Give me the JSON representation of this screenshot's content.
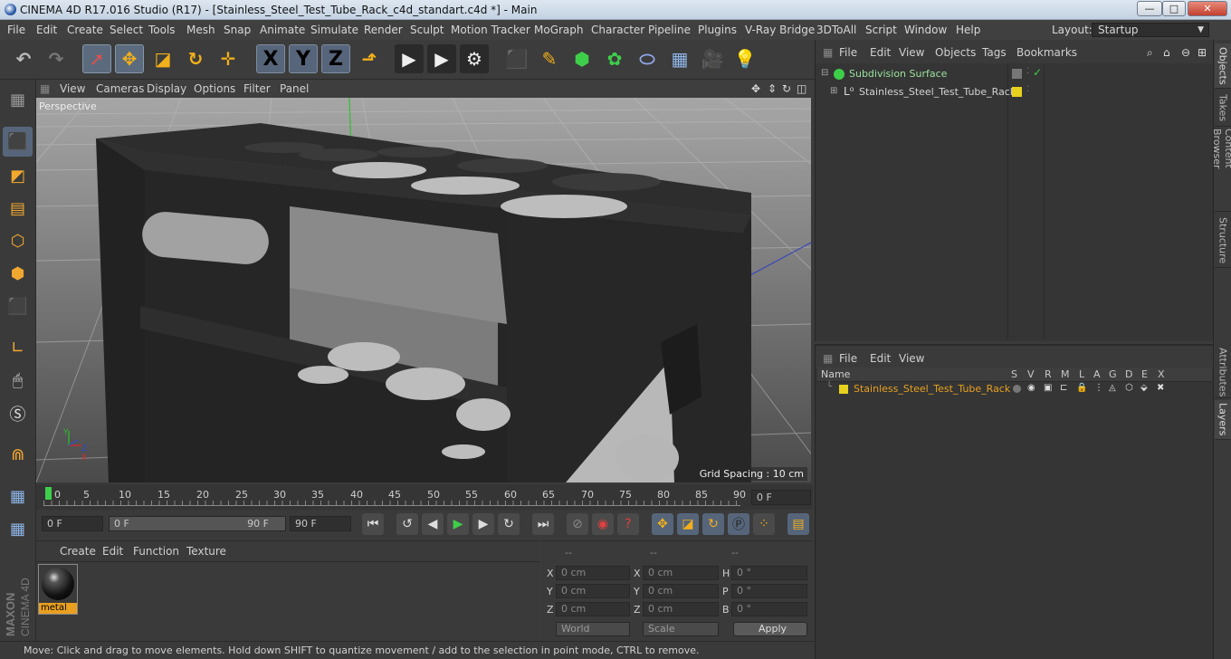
{
  "window": {
    "title": "CINEMA 4D R17.016 Studio (R17) - [Stainless_Steel_Test_Tube_Rack_c4d_standart.c4d *] - Main",
    "minimize": "—",
    "maximize": "□",
    "close": "✕"
  },
  "menu": {
    "items": [
      "File",
      "Edit",
      "Create",
      "Select",
      "Tools",
      "Mesh",
      "Snap",
      "Animate",
      "Simulate",
      "Render",
      "Sculpt",
      "Motion Tracker",
      "MoGraph",
      "Character",
      "Pipeline",
      "Plugins",
      "V-Ray Bridge",
      "3DToAll",
      "Script",
      "Window",
      "Help"
    ],
    "layout_label": "Layout:",
    "layout_value": "Startup"
  },
  "toolbar": {
    "axis_x": "X",
    "axis_y": "Y",
    "axis_z": "Z"
  },
  "viewport": {
    "menu": [
      "View",
      "Cameras",
      "Display",
      "Options",
      "Filter",
      "Panel"
    ],
    "label": "Perspective",
    "grid_spacing": "Grid Spacing : 10 cm",
    "axis_y": "Y",
    "axis_z": "Z",
    "axis_x": "X"
  },
  "timeline": {
    "ticks": [
      "0",
      "5",
      "10",
      "15",
      "20",
      "25",
      "30",
      "35",
      "40",
      "45",
      "50",
      "55",
      "60",
      "65",
      "70",
      "75",
      "80",
      "85",
      "90"
    ],
    "current_frame": "0 F"
  },
  "playback": {
    "start": "0 F",
    "range_start": "0 F",
    "range_end": "90 F",
    "end": "90 F"
  },
  "material_panel": {
    "menu": [
      "Create",
      "Edit",
      "Function",
      "Texture"
    ],
    "material_name": "metal"
  },
  "coords": {
    "headers": [
      "--",
      "--",
      "--"
    ],
    "pos": [
      {
        "axis": "X",
        "value": "0 cm"
      },
      {
        "axis": "Y",
        "value": "0 cm"
      },
      {
        "axis": "Z",
        "value": "0 cm"
      }
    ],
    "size": [
      {
        "axis": "X",
        "value": "0 cm"
      },
      {
        "axis": "Y",
        "value": "0 cm"
      },
      {
        "axis": "Z",
        "value": "0 cm"
      }
    ],
    "rot": [
      {
        "axis": "H",
        "value": "0 °"
      },
      {
        "axis": "P",
        "value": "0 °"
      },
      {
        "axis": "B",
        "value": "0 °"
      }
    ],
    "world": "World",
    "scale": "Scale",
    "apply": "Apply"
  },
  "status": {
    "text": "Move: Click and drag to move elements. Hold down SHIFT to quantize movement / add to the selection in point mode, CTRL to remove."
  },
  "objects_panel": {
    "menu": [
      "File",
      "Edit",
      "View",
      "Objects",
      "Tags",
      "Bookmarks"
    ],
    "items": [
      "Subdivision Surface",
      "Stainless_Steel_Test_Tube_Rack"
    ]
  },
  "layers_panel": {
    "menu": [
      "File",
      "Edit",
      "View"
    ],
    "col_name": "Name",
    "cols": [
      "S",
      "V",
      "R",
      "M",
      "L",
      "A",
      "G",
      "D",
      "E",
      "X"
    ],
    "layer_name": "Stainless_Steel_Test_Tube_Rack"
  },
  "side_tabs": [
    "Objects",
    "Takes",
    "Content Browser",
    "Structure",
    "Attributes",
    "Layers"
  ],
  "brand": {
    "line1": "MAXON",
    "line2": "CINEMA 4D"
  },
  "colors": {
    "accent": "#e8a020",
    "layer_yellow": "#e6d21e",
    "green": "#3ecf4a"
  }
}
